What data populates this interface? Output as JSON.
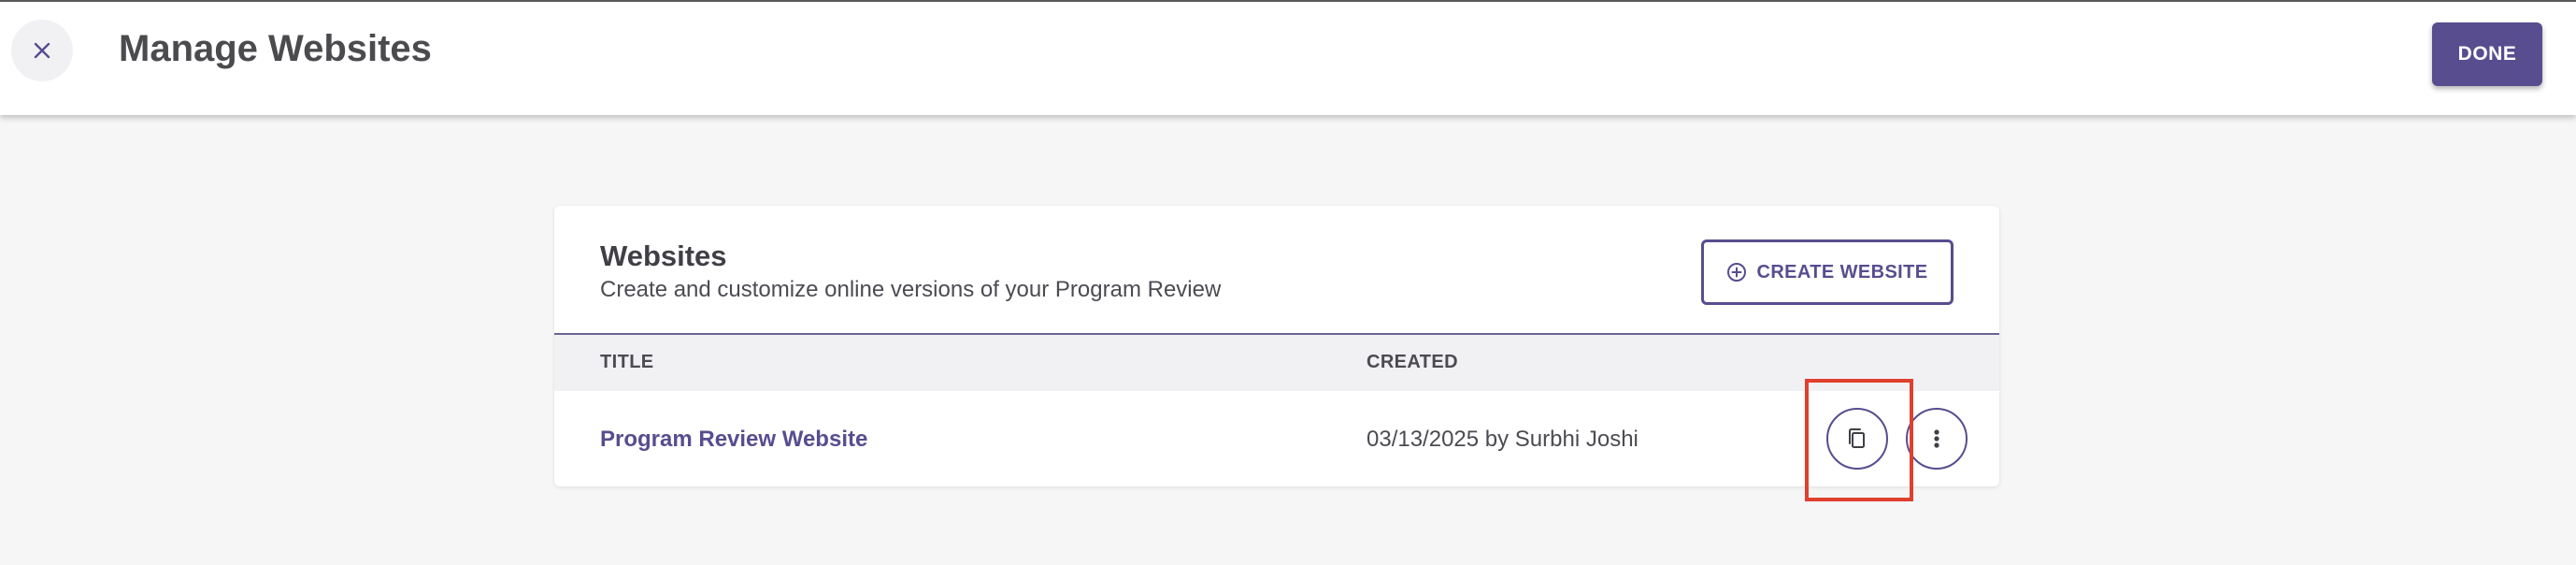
{
  "header": {
    "close_icon": "close-icon",
    "title": "Manage Websites",
    "done_label": "DONE"
  },
  "colors": {
    "accent": "#574d8f",
    "highlight": "#e0402d"
  },
  "websites": {
    "title": "Websites",
    "subtitle": "Create and customize online versions of your Program Review",
    "create_label": "CREATE WEBSITE",
    "create_icon": "plus-circle-icon",
    "columns": [
      "TITLE",
      "CREATED"
    ],
    "rows": [
      {
        "title": "Program Review Website",
        "created": "03/13/2025 by Surbhi Joshi",
        "copy_icon": "copy-icon",
        "more_icon": "more-vertical-icon"
      }
    ]
  }
}
